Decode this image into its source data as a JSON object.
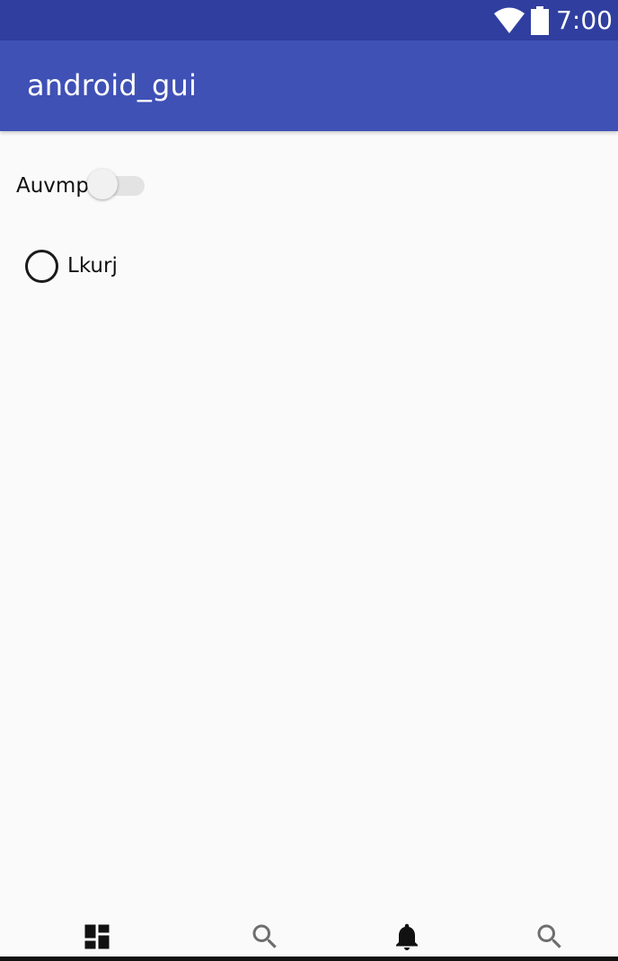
{
  "status_bar": {
    "time": "7:00",
    "icons": [
      "wifi-icon",
      "battery-icon"
    ]
  },
  "app_bar": {
    "title": "android_gui"
  },
  "content": {
    "switch": {
      "label": "Auvmp",
      "checked": false
    },
    "radio": {
      "label": "Lkurj",
      "checked": false
    }
  },
  "bottom_nav": {
    "items": [
      {
        "icon": "dashboard-icon",
        "active": true
      },
      {
        "icon": "search-icon",
        "active": false
      },
      {
        "icon": "notifications-icon",
        "active": true
      },
      {
        "icon": "search-icon",
        "active": false
      }
    ]
  },
  "colors": {
    "status_bar": "#303f9f",
    "app_bar": "#3f51b5",
    "background": "#fafafa"
  }
}
